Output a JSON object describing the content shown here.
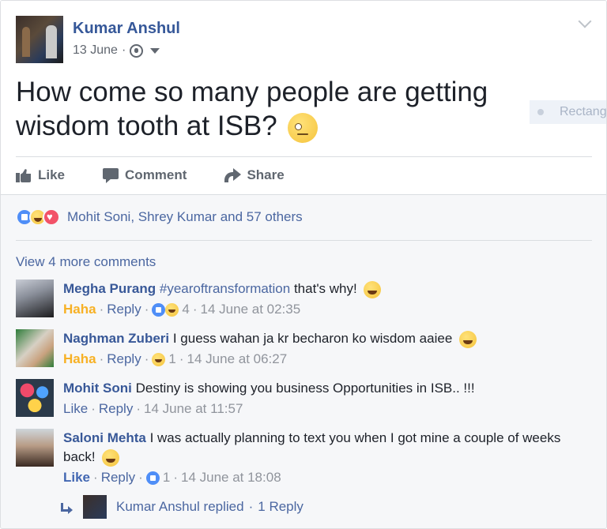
{
  "post": {
    "author": "Kumar Anshul",
    "date": "13 June",
    "separator": "·",
    "text": "How come so many people are getting wisdom tooth at ISB?",
    "ghost_label": "Rectang",
    "actions": {
      "like": "Like",
      "comment": "Comment",
      "share": "Share"
    }
  },
  "reactions": {
    "summary": "Mohit Soni, Shrey Kumar and 57 others"
  },
  "view_more": "View 4 more comments",
  "comments": [
    {
      "name": "Megha Purang",
      "tag": "#yearoftransformation",
      "text": " that's why!",
      "reaction_label": "Haha",
      "reply": "Reply",
      "count": "4",
      "time": "14 June at 02:35"
    },
    {
      "name": "Naghman Zuberi",
      "text": " I guess wahan ja kr becharon ko wisdom aaiee",
      "reaction_label": "Haha",
      "reply": "Reply",
      "count": "1",
      "time": "14 June at 06:27"
    },
    {
      "name": "Mohit Soni",
      "text": " Destiny is showing you business Opportunities in ISB.. !!!",
      "reaction_label": "Like",
      "reply": "Reply",
      "time": "14 June at 11:57"
    },
    {
      "name": "Saloni Mehta",
      "text": " I was actually planning to text you when I got mine a couple of weeks back!",
      "reaction_label": "Like",
      "reply": "Reply",
      "count": "1",
      "time": "14 June at 18:08"
    }
  ],
  "replies": {
    "text": "Kumar Anshul replied",
    "count_text": "1 Reply"
  },
  "colors": {
    "link": "#365899",
    "haha": "#f7b125",
    "like": "#4267b2",
    "meta": "#90949c"
  }
}
